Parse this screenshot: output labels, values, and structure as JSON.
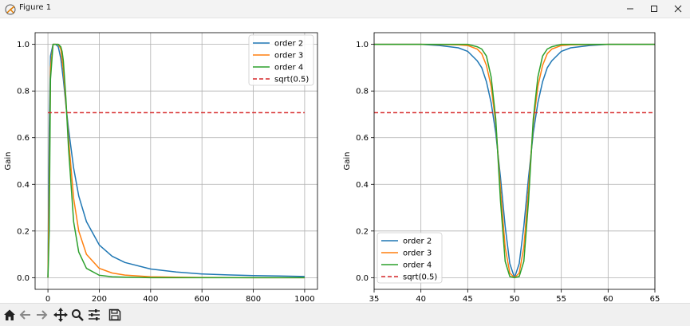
{
  "window": {
    "title": "Figure 1"
  },
  "toolbar": {
    "icons": [
      "home-icon",
      "back-arrow-icon",
      "forward-arrow-icon",
      "pan-icon",
      "zoom-icon",
      "configure-subplots-icon",
      "save-icon"
    ]
  },
  "colors": {
    "order2": "#1f77b4",
    "order3": "#ff7f0e",
    "order4": "#2ca02c",
    "ref": "#d62728"
  },
  "chart_data": [
    {
      "type": "line",
      "ylabel": "Gain",
      "xlim": [
        -50,
        1050
      ],
      "ylim": [
        -0.05,
        1.05
      ],
      "x_ticks": [
        0,
        200,
        400,
        600,
        800,
        1000
      ],
      "y_ticks": [
        "0.0",
        "0.2",
        "0.4",
        "0.6",
        "0.8",
        "1.0"
      ],
      "grid": true,
      "legend_position": "upper right",
      "series": [
        {
          "name": "order 2",
          "x": [
            0,
            5,
            10,
            20,
            30,
            40,
            50,
            60,
            70,
            80,
            100,
            120,
            150,
            200,
            250,
            300,
            400,
            500,
            600,
            700,
            800,
            900,
            1000
          ],
          "y": [
            0.0,
            0.64,
            0.95,
            1.0,
            1.0,
            0.99,
            0.94,
            0.85,
            0.74,
            0.64,
            0.47,
            0.35,
            0.24,
            0.14,
            0.092,
            0.065,
            0.037,
            0.024,
            0.016,
            0.012,
            0.009,
            0.007,
            0.005
          ]
        },
        {
          "name": "order 3",
          "x": [
            0,
            5,
            10,
            20,
            30,
            40,
            50,
            60,
            70,
            80,
            100,
            120,
            150,
            200,
            250,
            300,
            400,
            500,
            600,
            800,
            1000
          ],
          "y": [
            0.0,
            0.38,
            0.9,
            1.0,
            1.0,
            1.0,
            0.98,
            0.89,
            0.75,
            0.6,
            0.34,
            0.2,
            0.1,
            0.04,
            0.02,
            0.011,
            0.004,
            0.002,
            0.001,
            0.0,
            0.0
          ]
        },
        {
          "name": "order 4",
          "x": [
            0,
            5,
            10,
            20,
            30,
            40,
            50,
            55,
            60,
            70,
            80,
            100,
            120,
            150,
            200,
            250,
            300,
            400,
            600,
            800,
            1000
          ],
          "y": [
            0.0,
            0.2,
            0.85,
            1.0,
            1.0,
            1.0,
            0.99,
            0.97,
            0.93,
            0.77,
            0.56,
            0.24,
            0.11,
            0.04,
            0.01,
            0.004,
            0.002,
            0.0,
            0.0,
            0.0,
            0.0
          ]
        },
        {
          "name": "sqrt(0.5)",
          "x": [
            0,
            1000
          ],
          "y": [
            0.7071,
            0.7071
          ],
          "style": "dashed"
        }
      ]
    },
    {
      "type": "line",
      "ylabel": "Gain",
      "xlim": [
        35,
        65
      ],
      "ylim": [
        -0.05,
        1.05
      ],
      "x_ticks": [
        35,
        40,
        45,
        50,
        55,
        60,
        65
      ],
      "y_ticks": [
        "0.0",
        "0.2",
        "0.4",
        "0.6",
        "0.8",
        "1.0"
      ],
      "grid": true,
      "legend_position": "lower left",
      "series": [
        {
          "name": "order 2",
          "x": [
            35,
            40,
            42,
            44,
            45,
            46,
            46.5,
            47,
            47.5,
            48,
            48.5,
            49,
            49.5,
            50,
            50.5,
            51,
            51.5,
            52,
            52.5,
            53,
            53.5,
            54,
            55,
            56,
            58,
            60,
            65
          ],
          "y": [
            1.0,
            1.0,
            0.995,
            0.985,
            0.97,
            0.93,
            0.9,
            0.84,
            0.75,
            0.62,
            0.43,
            0.22,
            0.06,
            0.0,
            0.06,
            0.22,
            0.43,
            0.62,
            0.75,
            0.84,
            0.9,
            0.93,
            0.97,
            0.985,
            0.995,
            1.0,
            1.0
          ]
        },
        {
          "name": "order 3",
          "x": [
            35,
            40,
            44,
            45,
            46,
            46.5,
            47,
            47.5,
            48,
            48.5,
            49,
            49.5,
            50,
            50.5,
            51,
            51.5,
            52,
            52.5,
            53,
            53.5,
            54,
            55,
            56,
            60,
            65
          ],
          "y": [
            1.0,
            1.0,
            0.998,
            0.995,
            0.98,
            0.96,
            0.91,
            0.82,
            0.66,
            0.38,
            0.13,
            0.02,
            0.0,
            0.02,
            0.13,
            0.38,
            0.66,
            0.82,
            0.91,
            0.96,
            0.98,
            0.995,
            0.998,
            1.0,
            1.0
          ]
        },
        {
          "name": "order 4",
          "x": [
            35,
            40,
            45,
            46,
            46.5,
            47,
            47.5,
            48,
            48.5,
            49,
            49.5,
            50,
            50.5,
            51,
            51.5,
            52,
            52.5,
            53,
            53.5,
            54,
            55,
            60,
            65
          ],
          "y": [
            1.0,
            1.0,
            1.0,
            0.99,
            0.98,
            0.95,
            0.86,
            0.68,
            0.33,
            0.07,
            0.005,
            0.0,
            0.005,
            0.07,
            0.33,
            0.68,
            0.86,
            0.95,
            0.98,
            0.99,
            1.0,
            1.0,
            1.0
          ]
        },
        {
          "name": "sqrt(0.5)",
          "x": [
            35,
            65
          ],
          "y": [
            0.7071,
            0.7071
          ],
          "style": "dashed"
        }
      ]
    }
  ]
}
